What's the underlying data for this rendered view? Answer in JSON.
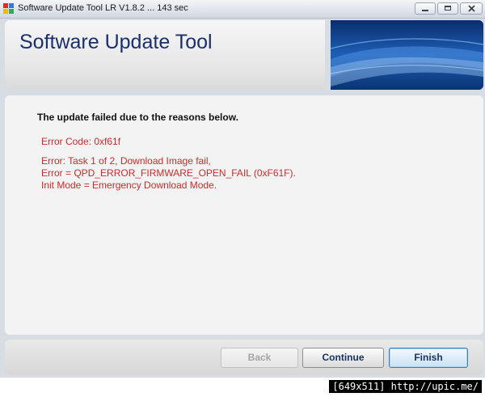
{
  "window": {
    "title": "Software Update Tool LR V1.8.2 ... 143 sec",
    "icon": "app-icon"
  },
  "header": {
    "title": "Software Update Tool"
  },
  "content": {
    "heading": "The update failed due to the reasons below.",
    "error_code": "Error Code: 0xf61f",
    "error_lines": [
      "Error: Task 1 of 2, Download Image fail,",
      "Error = QPD_ERROR_FIRMWARE_OPEN_FAIL (0xF61F).",
      "Init Mode = Emergency Download Mode."
    ],
    "error_color": "#cc2b2b"
  },
  "buttons": {
    "back": "Back",
    "continue": "Continue",
    "finish": "Finish"
  },
  "watermark": {
    "text": "[649x511] http://upic.me/"
  }
}
